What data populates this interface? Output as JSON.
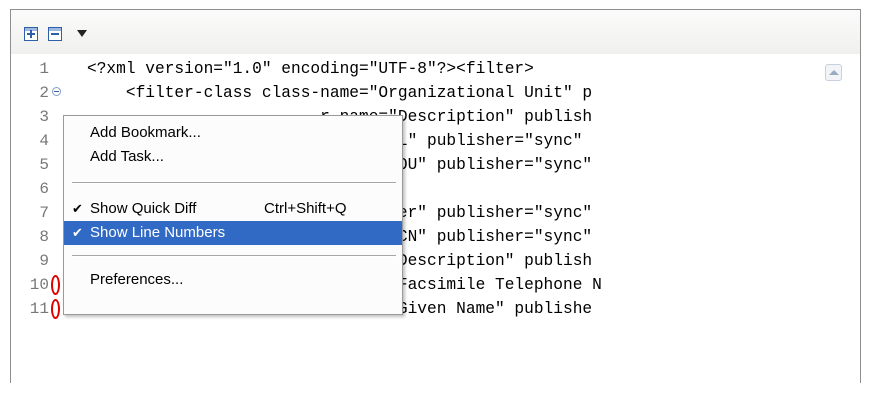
{
  "toolbar": {
    "icons": [
      "expand-all-icon",
      "collapse-all-icon",
      "view-menu-dropdown-icon"
    ]
  },
  "editor": {
    "lines": [
      {
        "num": "1",
        "text": "<?xml version=\"1.0\" encoding=\"UTF-8\"?><filter>"
      },
      {
        "num": "2",
        "text": "    <filter-class class-name=\"Organizational Unit\" p"
      },
      {
        "num": "3",
        "text": "                        r-name=\"Description\" publish"
      },
      {
        "num": "4",
        "text": "                        r-name=\"L\" publisher=\"sync\""
      },
      {
        "num": "5",
        "text": "                        r-name=\"OU\" publisher=\"sync\""
      },
      {
        "num": "6",
        "text": ""
      },
      {
        "num": "7",
        "text": "                        name=\"User\" publisher=\"sync\""
      },
      {
        "num": "8",
        "text": "                        r-name=\"CN\" publisher=\"sync\""
      },
      {
        "num": "9",
        "text": "        <filter-attr attr-name=\"Description\" publish"
      },
      {
        "num": "10",
        "text": "        <filter-attr attr-name=\"Facsimile Telephone N"
      },
      {
        "num": "11",
        "text": "        <filter-attr attr-name=\"Given Name\" publishe"
      }
    ]
  },
  "context_menu": {
    "add_bookmark": "Add Bookmark...",
    "add_task": "Add Task...",
    "show_quick_diff": "Show Quick Diff",
    "show_quick_diff_shortcut": "Ctrl+Shift+Q",
    "show_line_numbers": "Show Line Numbers",
    "preferences": "Preferences...",
    "check_mark": "✔"
  },
  "colors": {
    "selection": "#316ac5",
    "annotation": "#e00000"
  }
}
